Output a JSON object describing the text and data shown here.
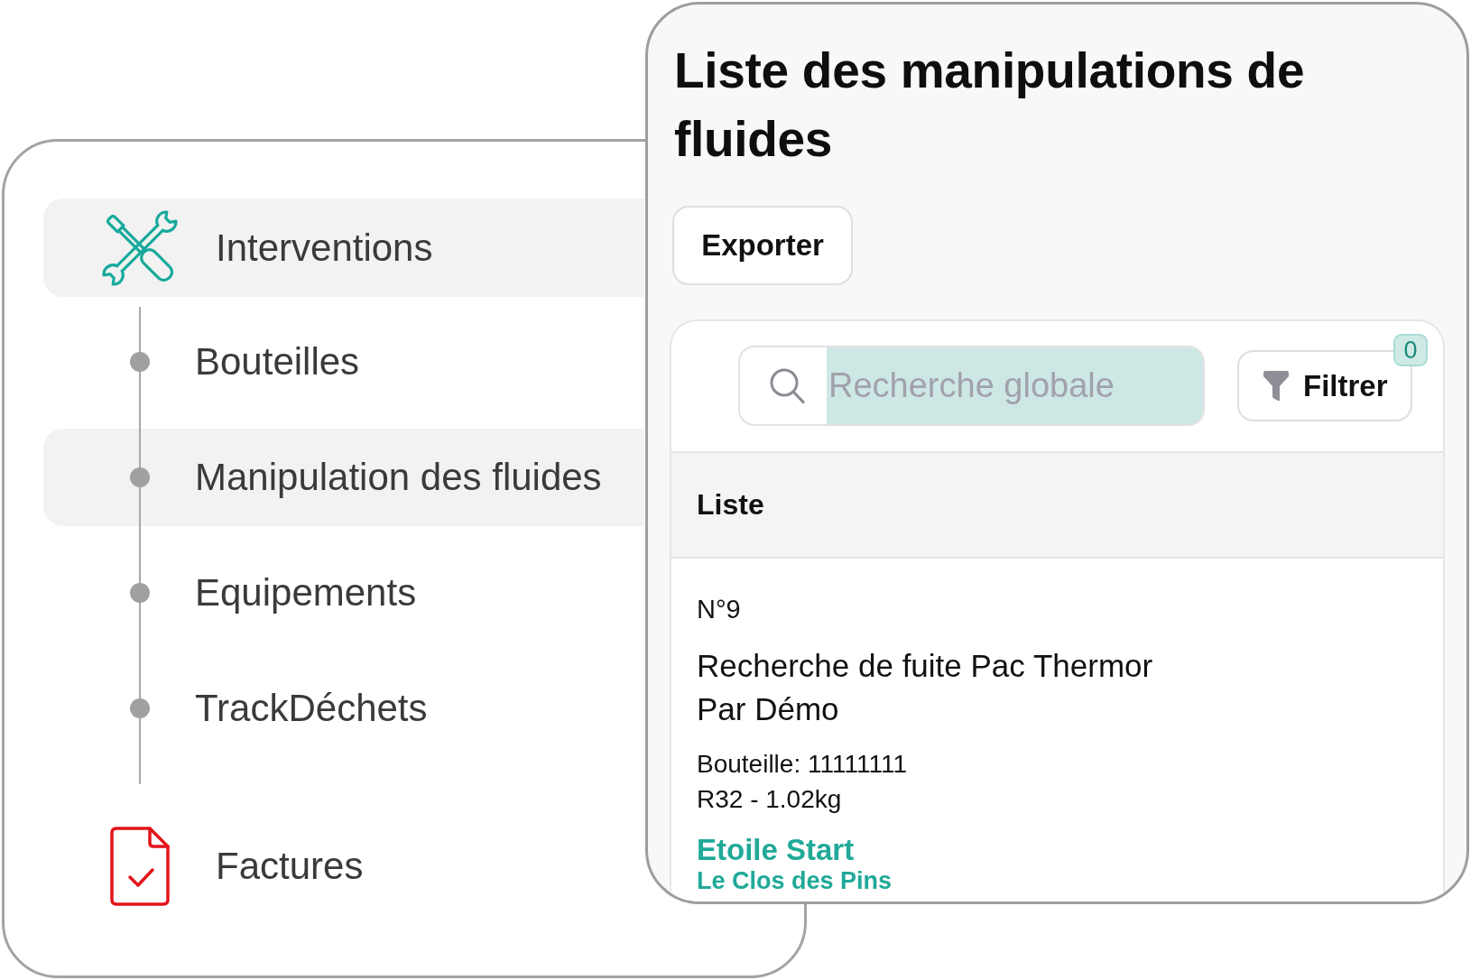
{
  "sidebar": {
    "items": [
      {
        "label": "Interventions",
        "selected": true,
        "children": [
          {
            "label": "Bouteilles",
            "selected": false
          },
          {
            "label": "Manipulation des fluides",
            "selected": true
          },
          {
            "label": "Equipements",
            "selected": false
          },
          {
            "label": "TrackDéchets",
            "selected": false
          }
        ]
      },
      {
        "label": "Factures",
        "selected": false
      }
    ]
  },
  "page": {
    "title": "Liste des manipulations de fluides",
    "export_button": "Exporter",
    "search": {
      "placeholder": "Recherche globale"
    },
    "filter_button": {
      "label": "Filtrer",
      "badge": "0"
    },
    "list": {
      "header": "Liste",
      "items": [
        {
          "number": "N°9",
          "title": "Recherche de fuite Pac Thermor",
          "author": "Par Démo",
          "bottle": "Bouteille: 11111111",
          "fluid": "R32 - 1.02kg",
          "client": "Etoile Start",
          "site": "Le Clos des Pins"
        }
      ]
    }
  }
}
